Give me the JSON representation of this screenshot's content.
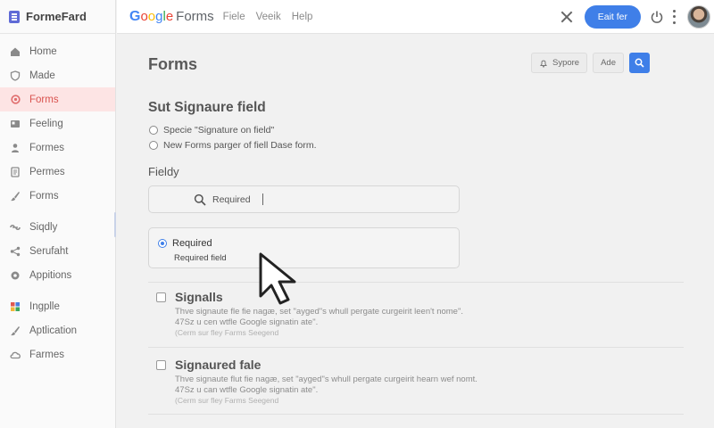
{
  "app": {
    "brand": "FormeFard",
    "product_google": "Google",
    "product_forms": "Forms",
    "menu": [
      "Fiele",
      "Veeik",
      "Help"
    ],
    "edit_button": "Eait fer"
  },
  "sidebar": {
    "items": [
      {
        "label": "Home",
        "icon": "home-icon"
      },
      {
        "label": "Made",
        "icon": "shield-icon"
      },
      {
        "label": "Forms",
        "icon": "settings-icon"
      },
      {
        "label": "Feeling",
        "icon": "feed-icon"
      },
      {
        "label": "Formes",
        "icon": "person-icon"
      },
      {
        "label": "Permes",
        "icon": "document-icon"
      },
      {
        "label": "Forms",
        "icon": "brush-icon"
      },
      {
        "label": "Siqdly",
        "icon": "link-icon"
      },
      {
        "label": "Serufaht",
        "icon": "share-icon"
      },
      {
        "label": "Appitions",
        "icon": "gear-icon"
      },
      {
        "label": "Ingplle",
        "icon": "grid-icon"
      },
      {
        "label": "Aptlication",
        "icon": "brush-icon"
      },
      {
        "label": "Farmes",
        "icon": "cloud-icon"
      }
    ],
    "active_index": 2
  },
  "main": {
    "title": "Forms",
    "actions": {
      "first": "Sypore",
      "second": "Ade"
    },
    "section_title": "Sut Signaure field",
    "options": [
      "Specie \"Signature on field\"",
      "New Forms parger of fiell Dase form."
    ],
    "field_label": "Fieldy",
    "search_value": "Required",
    "selected_option": {
      "title": "Required",
      "subtitle": "Required field"
    },
    "fields": [
      {
        "name": "Signalls",
        "desc1": "Thve signaute fle fie nagæ, set \"ayged\"s whull pergate curgeirit leen't nome\".",
        "desc2": "47Sz u cen wtfle Google signatin ate\".",
        "note": "(Cerm sur fley Farms Seegend"
      },
      {
        "name": "Signaured fale",
        "desc1": "Thve signaute flut fie nagæ, set \"ayged\"s whull pergate curgeirit hearn wef nomt.",
        "desc2": "47Sz u can wtfle Google signatin ate\".",
        "note": "(Cerm sur fley Farms Seegend"
      }
    ]
  },
  "colors": {
    "accent": "#3f7fe8",
    "active_bg": "#fde4e4",
    "active_text": "#d9534f"
  }
}
